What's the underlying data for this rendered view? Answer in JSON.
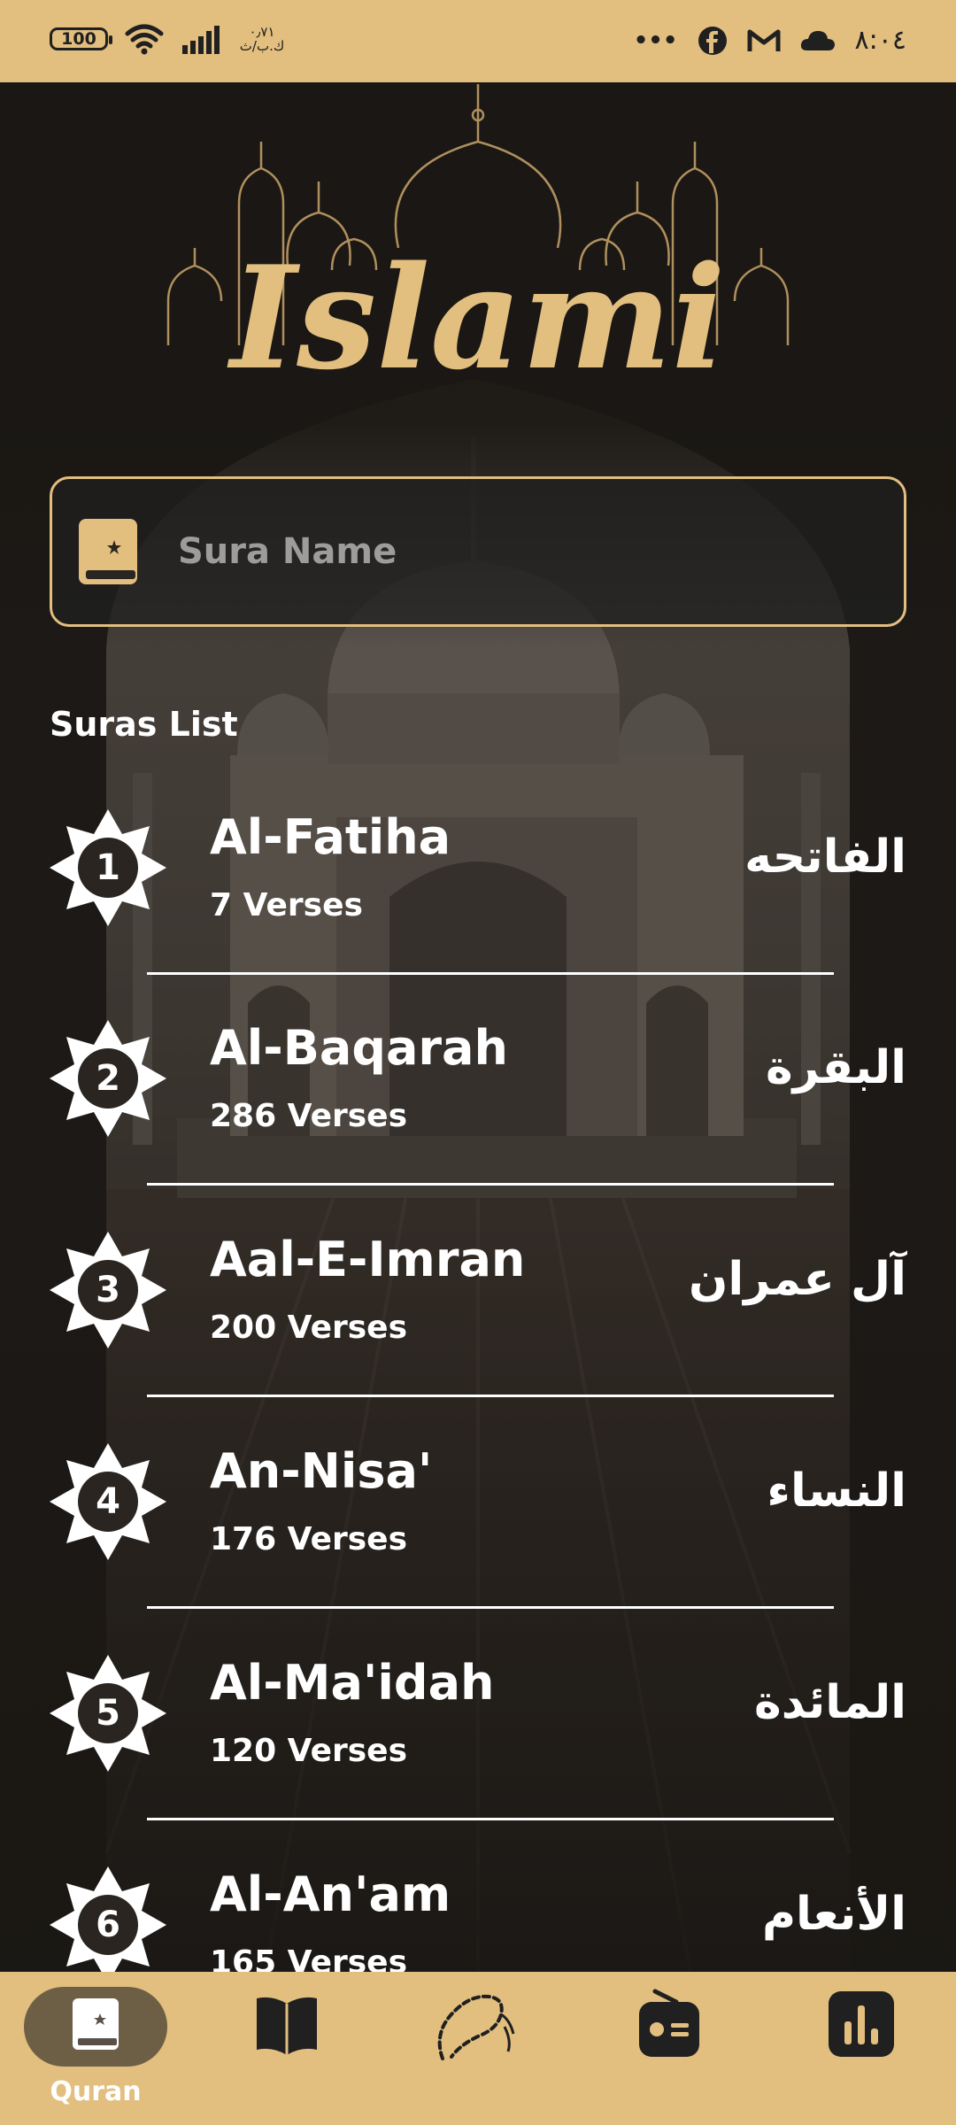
{
  "status_bar": {
    "battery": "100",
    "speed_top": "٠٫٧١",
    "speed_bottom": "ك.ب/ث",
    "more": "•••",
    "time": "٨:٠٤"
  },
  "app": {
    "logo_text": "Islami"
  },
  "search": {
    "placeholder": "Sura Name",
    "value": ""
  },
  "section_title": "Suras List",
  "suras": [
    {
      "number": "1",
      "name_en": "Al-Fatiha",
      "verses": "7 Verses",
      "name_ar": "الفاتحه"
    },
    {
      "number": "2",
      "name_en": "Al-Baqarah",
      "verses": "286 Verses",
      "name_ar": "البقرة"
    },
    {
      "number": "3",
      "name_en": "Aal-E-Imran",
      "verses": "200 Verses",
      "name_ar": "آل عمران"
    },
    {
      "number": "4",
      "name_en": "An-Nisa'",
      "verses": "176 Verses",
      "name_ar": "النساء"
    },
    {
      "number": "5",
      "name_en": "Al-Ma'idah",
      "verses": "120 Verses",
      "name_ar": "المائدة"
    },
    {
      "number": "6",
      "name_en": "Al-An'am",
      "verses": "165 Verses",
      "name_ar": "الأنعام"
    }
  ],
  "bottom_nav": {
    "active": "quran",
    "items": [
      {
        "id": "quran",
        "label": "Quran",
        "icon": "quran-book-icon"
      },
      {
        "id": "hadith",
        "label": "",
        "icon": "open-book-icon"
      },
      {
        "id": "sebha",
        "label": "",
        "icon": "prayer-beads-icon"
      },
      {
        "id": "radio",
        "label": "",
        "icon": "radio-icon"
      },
      {
        "id": "time",
        "label": "",
        "icon": "bar-chart-icon"
      }
    ]
  },
  "colors": {
    "accent": "#E2BE7F",
    "dark": "#202020",
    "text": "#FFFFFF"
  }
}
